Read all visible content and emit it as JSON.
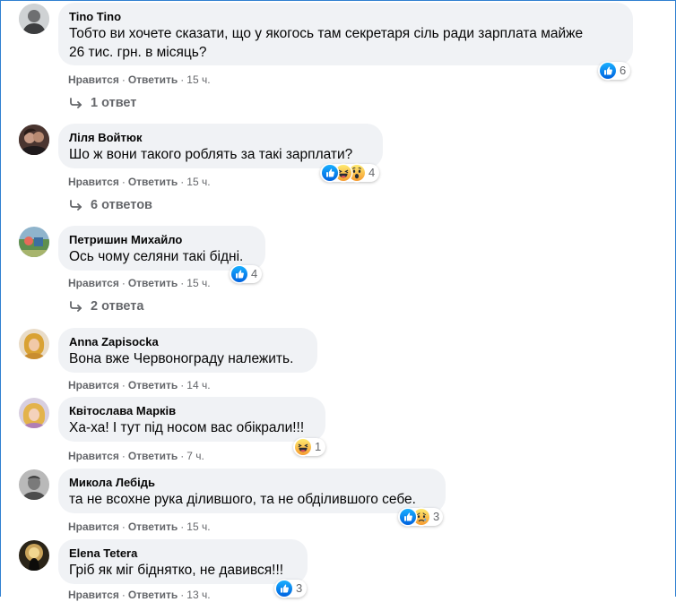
{
  "comments": [
    {
      "author": "Tino Tino",
      "text": "Тобто ви хочете сказати, що у якогось там секретаря сіль ради зарплата майже\n26 тис. грн. в місяць?",
      "like_label": "Нравится",
      "reply_label": "Ответить",
      "time": "15 ч.",
      "reactions": [
        "like"
      ],
      "reaction_count": "6",
      "replies_label": "1 ответ"
    },
    {
      "author": "Ліля Войтюк",
      "text": "Шо ж вони такого роблять за такі зарплати?",
      "like_label": "Нравится",
      "reply_label": "Ответить",
      "time": "15 ч.",
      "reactions": [
        "like",
        "haha",
        "wow"
      ],
      "reaction_count": "4",
      "replies_label": "6 ответов"
    },
    {
      "author": "Петришин Михайло",
      "text": "Ось чому селяни такі бідні.",
      "like_label": "Нравится",
      "reply_label": "Ответить",
      "time": "15 ч.",
      "reactions": [
        "like"
      ],
      "reaction_count": "4",
      "replies_label": "2 ответа"
    },
    {
      "author": "Anna Zapisocka",
      "text": "Вона вже Червонограду належить.",
      "like_label": "Нравится",
      "reply_label": "Ответить",
      "time": "14 ч.",
      "reactions": [],
      "reaction_count": "",
      "replies_label": ""
    },
    {
      "author": "Квітослава Марків",
      "text": "Ха-ха! І тут під носом вас обікрали!!!",
      "like_label": "Нравится",
      "reply_label": "Ответить",
      "time": "7 ч.",
      "reactions": [
        "haha"
      ],
      "reaction_count": "1",
      "replies_label": ""
    },
    {
      "author": "Микола Лебідь",
      "text": "та не всохне рука ділившого, та не обділившого себе.",
      "like_label": "Нравится",
      "reply_label": "Ответить",
      "time": "15 ч.",
      "reactions": [
        "like",
        "sad"
      ],
      "reaction_count": "3",
      "replies_label": ""
    },
    {
      "author": "Elena Tetera",
      "text": "Гріб як міг біднятко, не давився!!!",
      "like_label": "Нравится",
      "reply_label": "Ответить",
      "time": "13 ч.",
      "reactions": [
        "like"
      ],
      "reaction_count": "3",
      "replies_label": ""
    }
  ],
  "colors": {
    "like": "#1877f2",
    "haha": "#f7b125",
    "bubble": "#f0f2f5",
    "meta": "#65676b",
    "frame": "#2f80d0"
  }
}
